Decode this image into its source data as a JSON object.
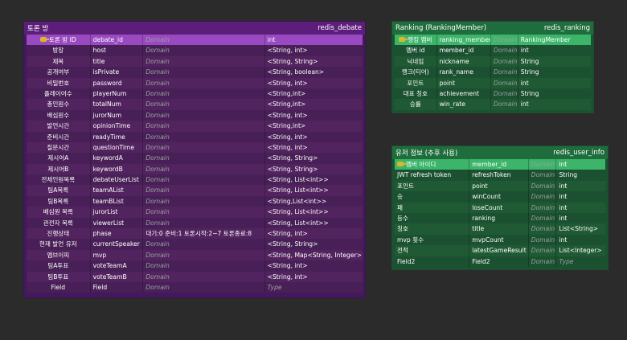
{
  "debate": {
    "title": "토론 방",
    "name": "redis_debate",
    "rows": [
      [
        "토론 방 ID",
        "debate_id",
        "Domain",
        "int"
      ],
      [
        "방장",
        "host",
        "Domain",
        "<String, int>"
      ],
      [
        "제목",
        "title",
        "Domain",
        "<String, String>"
      ],
      [
        "공개여부",
        "isPrivate",
        "Domain",
        "<String, boolean>"
      ],
      [
        "비밀번호",
        "password",
        "Domain",
        "<String, int>"
      ],
      [
        "플레이어수",
        "playerNum",
        "Domain",
        "<String,int>"
      ],
      [
        "총인원수",
        "totalNum",
        "Domain",
        "<String,int>"
      ],
      [
        "배심원수",
        "jurorNum",
        "Domain",
        "<String, int>"
      ],
      [
        "발언시간",
        "opinionTime",
        "Domain",
        "<String,int>"
      ],
      [
        "준비시간",
        "readyTime",
        "Domain",
        "<String, int>"
      ],
      [
        "질문시간",
        "questionTime",
        "Domain",
        "<String, int>"
      ],
      [
        "제시어A",
        "keywordA",
        "Domain",
        "<String, String>"
      ],
      [
        "제시어B",
        "keywordB",
        "Domain",
        "<String, String>"
      ],
      [
        "전체인원목록",
        "debateUserList",
        "Domain",
        "<String, List<int>>"
      ],
      [
        "팀A목록",
        "teamAList",
        "Domain",
        "<String, List<int>>"
      ],
      [
        "팀B목록",
        "teamBList",
        "Domain",
        "<String,List<int>>"
      ],
      [
        "배심원 목록",
        "jurorList",
        "Domain",
        "<String, List<int>>"
      ],
      [
        "관전자 목록",
        "viewerList",
        "Domain",
        "<String, List<int>>"
      ],
      [
        "진행상태",
        "phase",
        "대기:0 준비:1 토론시작:2~7 토론종료:8",
        "<String, int>"
      ],
      [
        "현재 발언 유저",
        "currentSpeaker",
        "Domain",
        "<String, String>"
      ],
      [
        "엠브이피",
        "mvp",
        "Domain",
        "<String, Map<String, Integer>>"
      ],
      [
        "팀A투표",
        "voteTeamA",
        "Domain",
        "<String, int>"
      ],
      [
        "팀B투표",
        "voteTeamB",
        "Domain",
        "<String, int>"
      ],
      [
        "Field",
        "Field",
        "Domain",
        "Type"
      ]
    ],
    "dim": [
      false,
      false,
      false,
      false,
      false,
      false,
      false,
      false,
      false,
      false,
      false,
      false,
      false,
      false,
      false,
      false,
      false,
      false,
      false,
      false,
      false,
      false,
      false,
      true
    ]
  },
  "ranking": {
    "title": "Ranking (RankingMember)",
    "name": "redis_ranking",
    "rows": [
      [
        "랭킹 멤버",
        "ranking_member",
        "Domain",
        "RankingMember"
      ],
      [
        "멤버 id",
        "member_id",
        "Domain",
        "int"
      ],
      [
        "닉네임",
        "nickname",
        "Domain",
        "String"
      ],
      [
        "랭크(티어)",
        "rank_name",
        "Domain",
        "String"
      ],
      [
        "포인트",
        "point",
        "Domain",
        "int"
      ],
      [
        "대표 칭호",
        "achievement",
        "Domain",
        "String"
      ],
      [
        "승률",
        "win_rate",
        "Domain",
        "int"
      ]
    ]
  },
  "user": {
    "title": "유저 정보 (추후 사용)",
    "name": "redis_user_info",
    "rows": [
      [
        "멤버 아이디",
        "member_id",
        "Domain",
        "int"
      ],
      [
        "JWT refresh token",
        "refreshToken",
        "Domain",
        "String"
      ],
      [
        "포인트",
        "point",
        "Domain",
        "int"
      ],
      [
        "승",
        "winCount",
        "Domain",
        "int"
      ],
      [
        "패",
        "loseCount",
        "Domain",
        "int"
      ],
      [
        "등수",
        "ranking",
        "Domain",
        "int"
      ],
      [
        "칭호",
        "title",
        "Domain",
        "List<String>"
      ],
      [
        "mvp 횟수",
        "mvpCount",
        "Domain",
        "int"
      ],
      [
        "전적",
        "latestGameResult",
        "Domain",
        "List<Integer>"
      ],
      [
        "Field2",
        "Field2",
        "Domain",
        "Type"
      ]
    ],
    "dim": [
      false,
      false,
      false,
      false,
      false,
      false,
      false,
      false,
      false,
      true
    ]
  },
  "colors": {
    "purple": "#43195c",
    "purple_pk": "#9a4ac0",
    "green": "#1a5330",
    "green_pk": "#3cb56a",
    "background": "#2b2b2b"
  },
  "icons": {
    "primary_key": "key-icon"
  }
}
